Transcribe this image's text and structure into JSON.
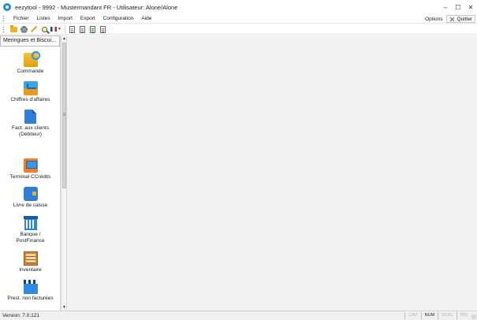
{
  "window": {
    "title": "eezytool - 9992 - Mustermandant FR - Utilisateur: Alone/Alone",
    "controls": {
      "minimize": "–",
      "maximize": "☐",
      "close": "✕"
    }
  },
  "menu": {
    "items": [
      "Fichier",
      "Listes",
      "Import",
      "Export",
      "Configuration",
      "Aide"
    ],
    "options_label": "Options",
    "quit_label": "Quitter"
  },
  "toolbar": {
    "icons": [
      "folder-icon",
      "gear-icon",
      "wrench-icon",
      "magnifier-icon",
      "french-flag-icon",
      "document-icon",
      "green-document-icon",
      "yellow-document-icon",
      "red-document-icon"
    ]
  },
  "sidebar": {
    "header": "Meringues et Biscui...",
    "items": [
      {
        "label": "Commande",
        "icon": "order-icon"
      },
      {
        "label": "Chiffres d'affaires",
        "icon": "revenue-chart-icon"
      },
      {
        "label": "Fact. aux clients",
        "label2": "(Débiteur)",
        "icon": "customer-invoice-icon"
      },
      {
        "label": "Terminal CCrédits",
        "icon": "credit-terminal-icon"
      },
      {
        "label": "Livre de caisse",
        "icon": "cash-book-icon"
      },
      {
        "label": "Banque /",
        "label2": "PostFinance",
        "icon": "bank-icon"
      },
      {
        "label": "Inventaire",
        "icon": "inventory-icon"
      },
      {
        "label": "Prest. non facturées",
        "icon": "clapperboard-icon"
      }
    ]
  },
  "statusbar": {
    "version": "Version: 7.0.121",
    "indicators": [
      {
        "label": "CAP",
        "active": false
      },
      {
        "label": "NUM",
        "active": true
      },
      {
        "label": "SCRL",
        "active": false
      },
      {
        "label": "INS",
        "active": false
      }
    ]
  },
  "colors": {
    "accent": "#1e90d6",
    "main_background": "#f2f2f2",
    "statusbar_background": "#f0f0f0"
  }
}
